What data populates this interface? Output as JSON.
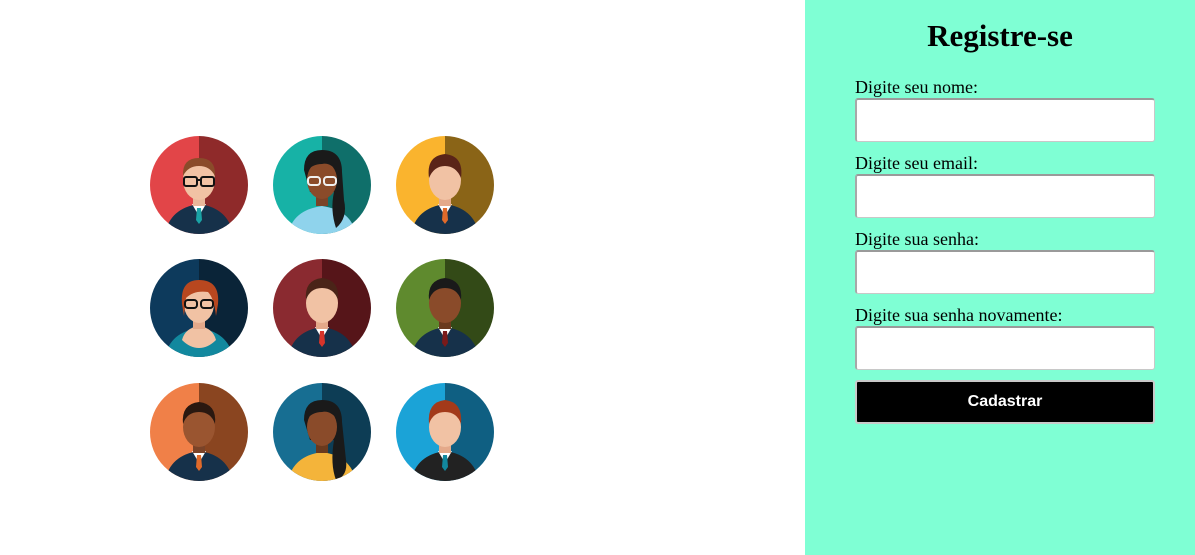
{
  "register": {
    "title": "Registre-se",
    "fields": [
      {
        "label": "Digite seu nome:",
        "value": "",
        "placeholder": ""
      },
      {
        "label": "Digite seu email:",
        "value": "",
        "placeholder": ""
      },
      {
        "label": "Digite sua senha:",
        "value": "",
        "placeholder": ""
      },
      {
        "label": "Digite sua senha novamente:",
        "value": "",
        "placeholder": ""
      }
    ],
    "submit_label": "Cadastrar"
  },
  "colors": {
    "panel_bg": "#7fffd4",
    "button_bg": "#000000",
    "button_text": "#ffffff"
  },
  "avatars": [
    {
      "name": "man-glasses-teal-tie",
      "bg": "#e24548"
    },
    {
      "name": "woman-glasses",
      "bg": "#17b2a6"
    },
    {
      "name": "man-orange-tie",
      "bg": "#fab42e"
    },
    {
      "name": "woman-red-hair-glasses",
      "bg": "#0d3a5c"
    },
    {
      "name": "man-red-tie",
      "bg": "#8a2a30"
    },
    {
      "name": "man-dark-skin",
      "bg": "#5f8a2e"
    },
    {
      "name": "man-orange-bg",
      "bg": "#f08048"
    },
    {
      "name": "woman-braids",
      "bg": "#176e92"
    },
    {
      "name": "man-red-hair",
      "bg": "#1ba3d7"
    }
  ]
}
